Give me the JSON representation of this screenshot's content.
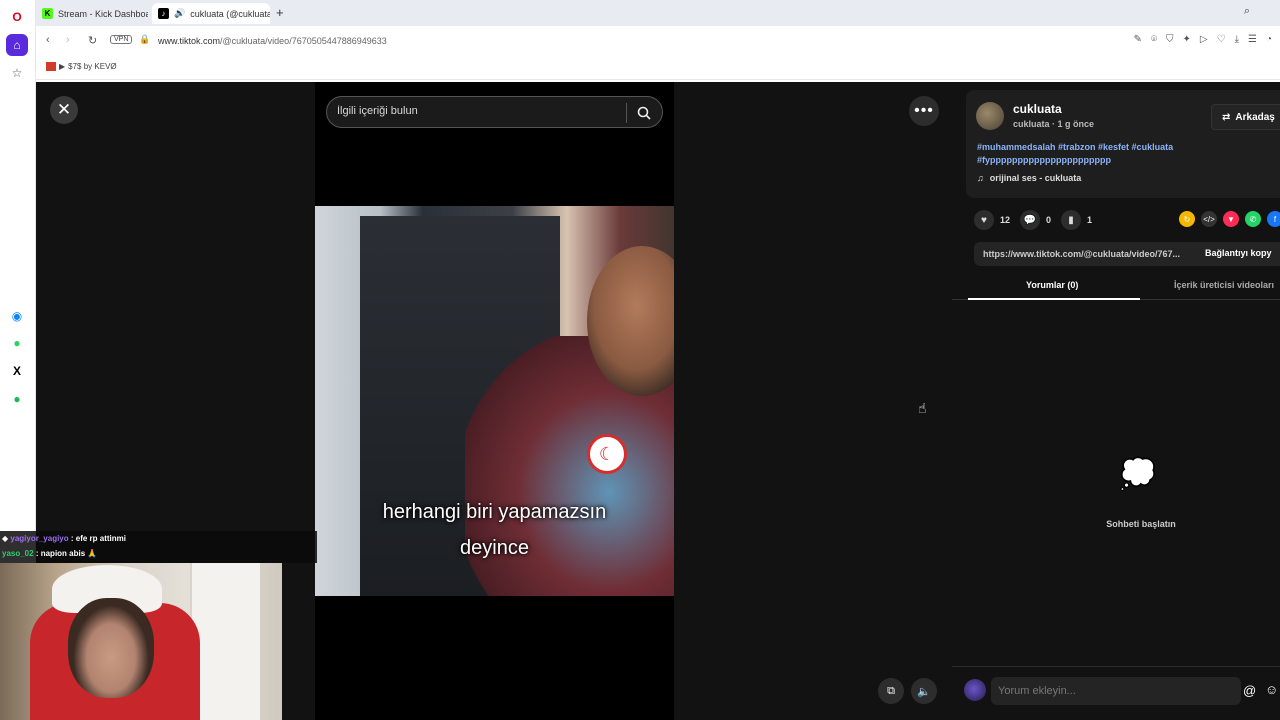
{
  "browser": {
    "tabs": [
      {
        "title": "Stream - Kick Dashboard",
        "active": false
      },
      {
        "title": "cukluata (@cukluata) |",
        "active": true
      }
    ],
    "vpn_label": "VPN",
    "url_host": "www.tiktok.com",
    "url_path": "/@cukluata/video/7670505447886949633",
    "bookmark": "$7$ by KEVØ"
  },
  "search": {
    "placeholder": "İlgili içeriği bulun"
  },
  "video": {
    "caption_line1": "herhangi biri yapamazsın",
    "caption_line2": "deyince"
  },
  "post": {
    "username": "cukluata",
    "subline": "cukluata · 1 g önce",
    "follow_label": "Arkadaş",
    "hashtags": "#muhammedsalah #trabzon #kesfet #cukluata #fypppppppppppppppppppppp",
    "music": "orijinal ses - cukluata",
    "likes": "12",
    "comments": "0",
    "saves": "1",
    "link": "https://www.tiktok.com/@cukluata/video/767...",
    "copy_label": "Bağlantıyı kopy"
  },
  "panel_tabs": {
    "comments": "Yorumlar (0)",
    "creator": "İçerik üreticisi videoları"
  },
  "empty_state": "Sohbeti başlatın",
  "comment_input": {
    "placeholder": "Yorum ekleyin..."
  },
  "chat": [
    {
      "user": "yagiyor_yagiyo",
      "msg": ": efe rp attinmi"
    },
    {
      "user": "yaso_02",
      "msg": ": napion abis 🙏"
    }
  ],
  "colors": {
    "accent": "#fe2c55",
    "link": "#8ab4f8",
    "kick": "#53fc18"
  }
}
